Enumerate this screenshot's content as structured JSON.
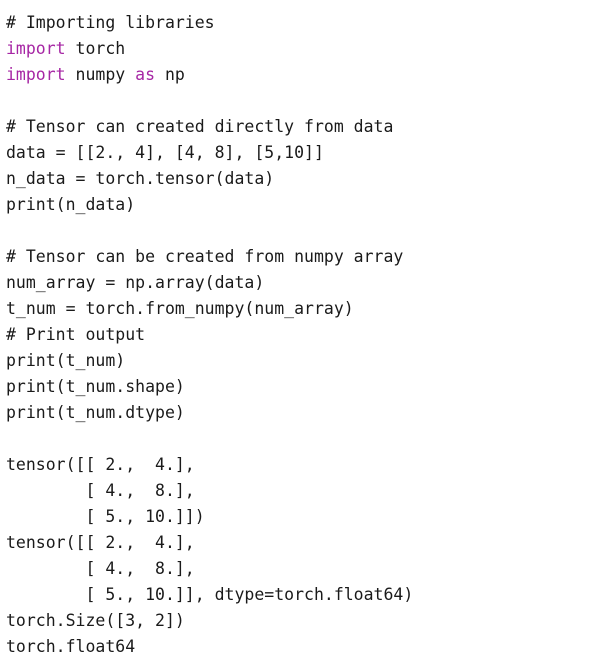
{
  "source_lines": [
    [
      {
        "text": "# Importing libraries",
        "kind": "comment"
      }
    ],
    [
      {
        "text": "import",
        "kind": "keyword"
      },
      {
        "text": " torch",
        "kind": "plain"
      }
    ],
    [
      {
        "text": "import",
        "kind": "keyword"
      },
      {
        "text": " numpy ",
        "kind": "plain"
      },
      {
        "text": "as",
        "kind": "keyword"
      },
      {
        "text": " np",
        "kind": "plain"
      }
    ],
    [],
    [
      {
        "text": "# Tensor can created directly from data",
        "kind": "comment"
      }
    ],
    [
      {
        "text": "data = [[2., 4], [4, 8], [5,10]]",
        "kind": "plain"
      }
    ],
    [
      {
        "text": "n_data = torch.tensor(data)",
        "kind": "plain"
      }
    ],
    [
      {
        "text": "print(n_data)",
        "kind": "plain"
      }
    ],
    [],
    [
      {
        "text": "# Tensor can be created from numpy array",
        "kind": "comment"
      }
    ],
    [
      {
        "text": "num_array = np.array(data)",
        "kind": "plain"
      }
    ],
    [
      {
        "text": "t_num = torch.from_numpy(num_array)",
        "kind": "plain"
      }
    ],
    [
      {
        "text": "# Print output",
        "kind": "comment"
      }
    ],
    [
      {
        "text": "print(t_num)",
        "kind": "plain"
      }
    ],
    [
      {
        "text": "print(t_num.shape)",
        "kind": "plain"
      }
    ],
    [
      {
        "text": "print(t_num.dtype)",
        "kind": "plain"
      }
    ],
    [],
    [
      {
        "text": "tensor([[ 2.,  4.],",
        "kind": "plain"
      }
    ],
    [
      {
        "text": "        [ 4.,  8.],",
        "kind": "plain"
      }
    ],
    [
      {
        "text": "        [ 5., 10.]])",
        "kind": "plain"
      }
    ],
    [
      {
        "text": "tensor([[ 2.,  4.],",
        "kind": "plain"
      }
    ],
    [
      {
        "text": "        [ 4.,  8.],",
        "kind": "plain"
      }
    ],
    [
      {
        "text": "        [ 5., 10.]], dtype=torch.float64)",
        "kind": "plain"
      }
    ],
    [
      {
        "text": "torch.Size([3, 2])",
        "kind": "plain"
      }
    ],
    [
      {
        "text": "torch.float64",
        "kind": "plain"
      }
    ]
  ],
  "colors": {
    "background": "#ffffff",
    "text": "#1a1a1a",
    "keyword": "#a626a4"
  }
}
